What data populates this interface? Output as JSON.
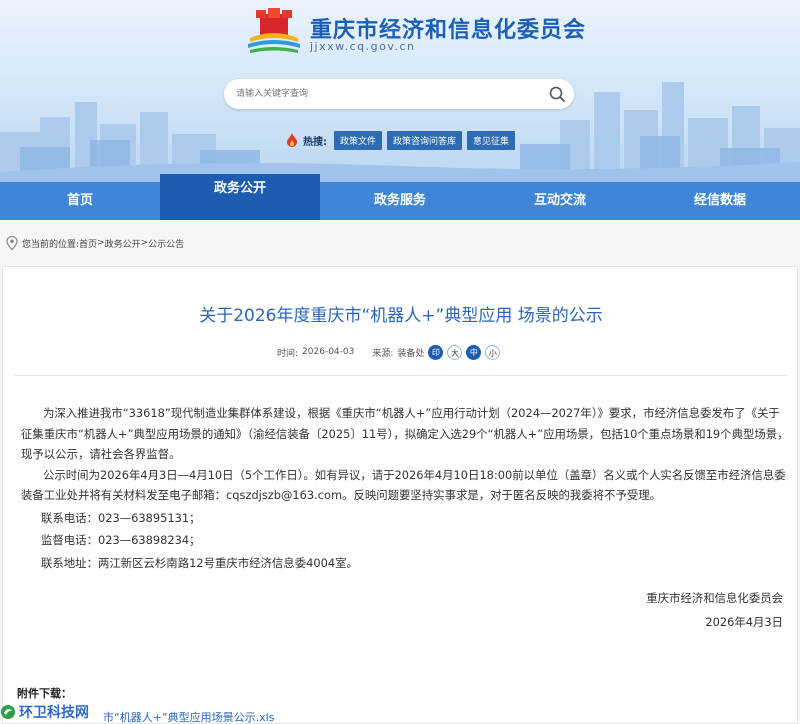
{
  "header": {
    "site_title": "重庆市经济和信息化委员会",
    "site_url": "jjxxw.cq.gov.cn",
    "logo_icon": "government-emblem-logo"
  },
  "search": {
    "placeholder": "请输入关键字查询",
    "icon": "search-icon"
  },
  "hotwords": {
    "label": "热搜:",
    "tags": [
      "政策文件",
      "政策咨询问答库",
      "意见征集"
    ]
  },
  "nav": {
    "items": [
      "首页",
      "政务公开",
      "政务服务",
      "互动交流",
      "经信数据"
    ],
    "active_index": 1
  },
  "breadcrumb": {
    "prefix": "您当前的位置:",
    "items": [
      "首页",
      "政务公开",
      "公示公告"
    ],
    "separator": ">"
  },
  "article": {
    "title": "关于2026年度重庆市“机器人+”典型应用 场景的公示",
    "time_label": "时间:",
    "time_value": "2026-04-03",
    "source_label": "来源:",
    "source_value": "装备处",
    "font_sizes": [
      "大",
      "中",
      "小"
    ],
    "font_active": "中",
    "print_glyph": "印",
    "paragraphs": [
      "为深入推进我市“33618”现代制造业集群体系建设，根据《重庆市“机器人+”应用行动计划（2024—2027年）》要求，市经济信息委发布了《关于征集重庆市“机器人+”典型应用场景的通知》（渝经信装备〔2025〕11号），拟确定入选29个“机器人+”应用场景，包括10个重点场景和19个典型场景，现予以公示，请社会各界监督。",
      "公示时间为2026年4月3日—4月10日（5个工作日）。如有异议，请于2026年4月10日18:00前以单位（盖章）名义或个人实名反馈至市经济信息委装备工业处并将有关材料发至电子邮箱：cqszdjszb@163.com。反映问题要坚持实事求是，对于匿名反映的我委将不予受理。",
      "联系电话：023—63895131；",
      "监督电话：023—63898234；",
      "联系地址：两江新区云杉南路12号重庆市经济信息委4004室。"
    ],
    "signature_org": "重庆市经济和信息化委员会",
    "signature_date": "2026年4月3日",
    "attachment_label": "附件下载：",
    "attachment_file": "市“机器人+”典型应用场景公示.xls"
  },
  "watermark": {
    "text": "环卫科技网"
  },
  "colors": {
    "brand_blue": "#1c5fb8",
    "nav_blue": "#3f86d8",
    "nav_active": "#1c5db3",
    "title_blue": "#2b66b7"
  }
}
